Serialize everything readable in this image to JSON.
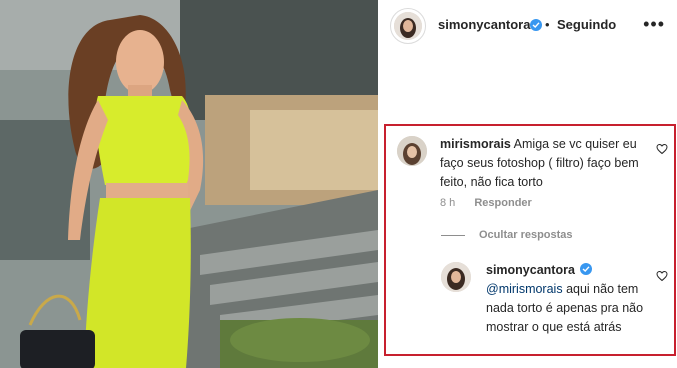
{
  "post": {
    "author": "simonycantora",
    "follow_status": "Seguindo",
    "separator": "•"
  },
  "comment": {
    "username": "mirismorais",
    "text": "Amiga se vc quiser eu faço seus fotoshop ( filtro) faço bem feito, não fica torto",
    "time": "8 h",
    "reply_label": "Responder"
  },
  "replies_toggle": "Ocultar respostas",
  "reply": {
    "username": "simonycantora",
    "mention": "@mirismorais",
    "text": "aqui não tem nada torto é apenas pra não mostrar o que está atrás"
  },
  "colors": {
    "highlight_border": "#c7202e",
    "verified_badge": "#3897f0",
    "outfit": "#d7ec2c"
  },
  "icons": [
    "verified-badge-icon",
    "more-options-icon",
    "heart-icon"
  ]
}
